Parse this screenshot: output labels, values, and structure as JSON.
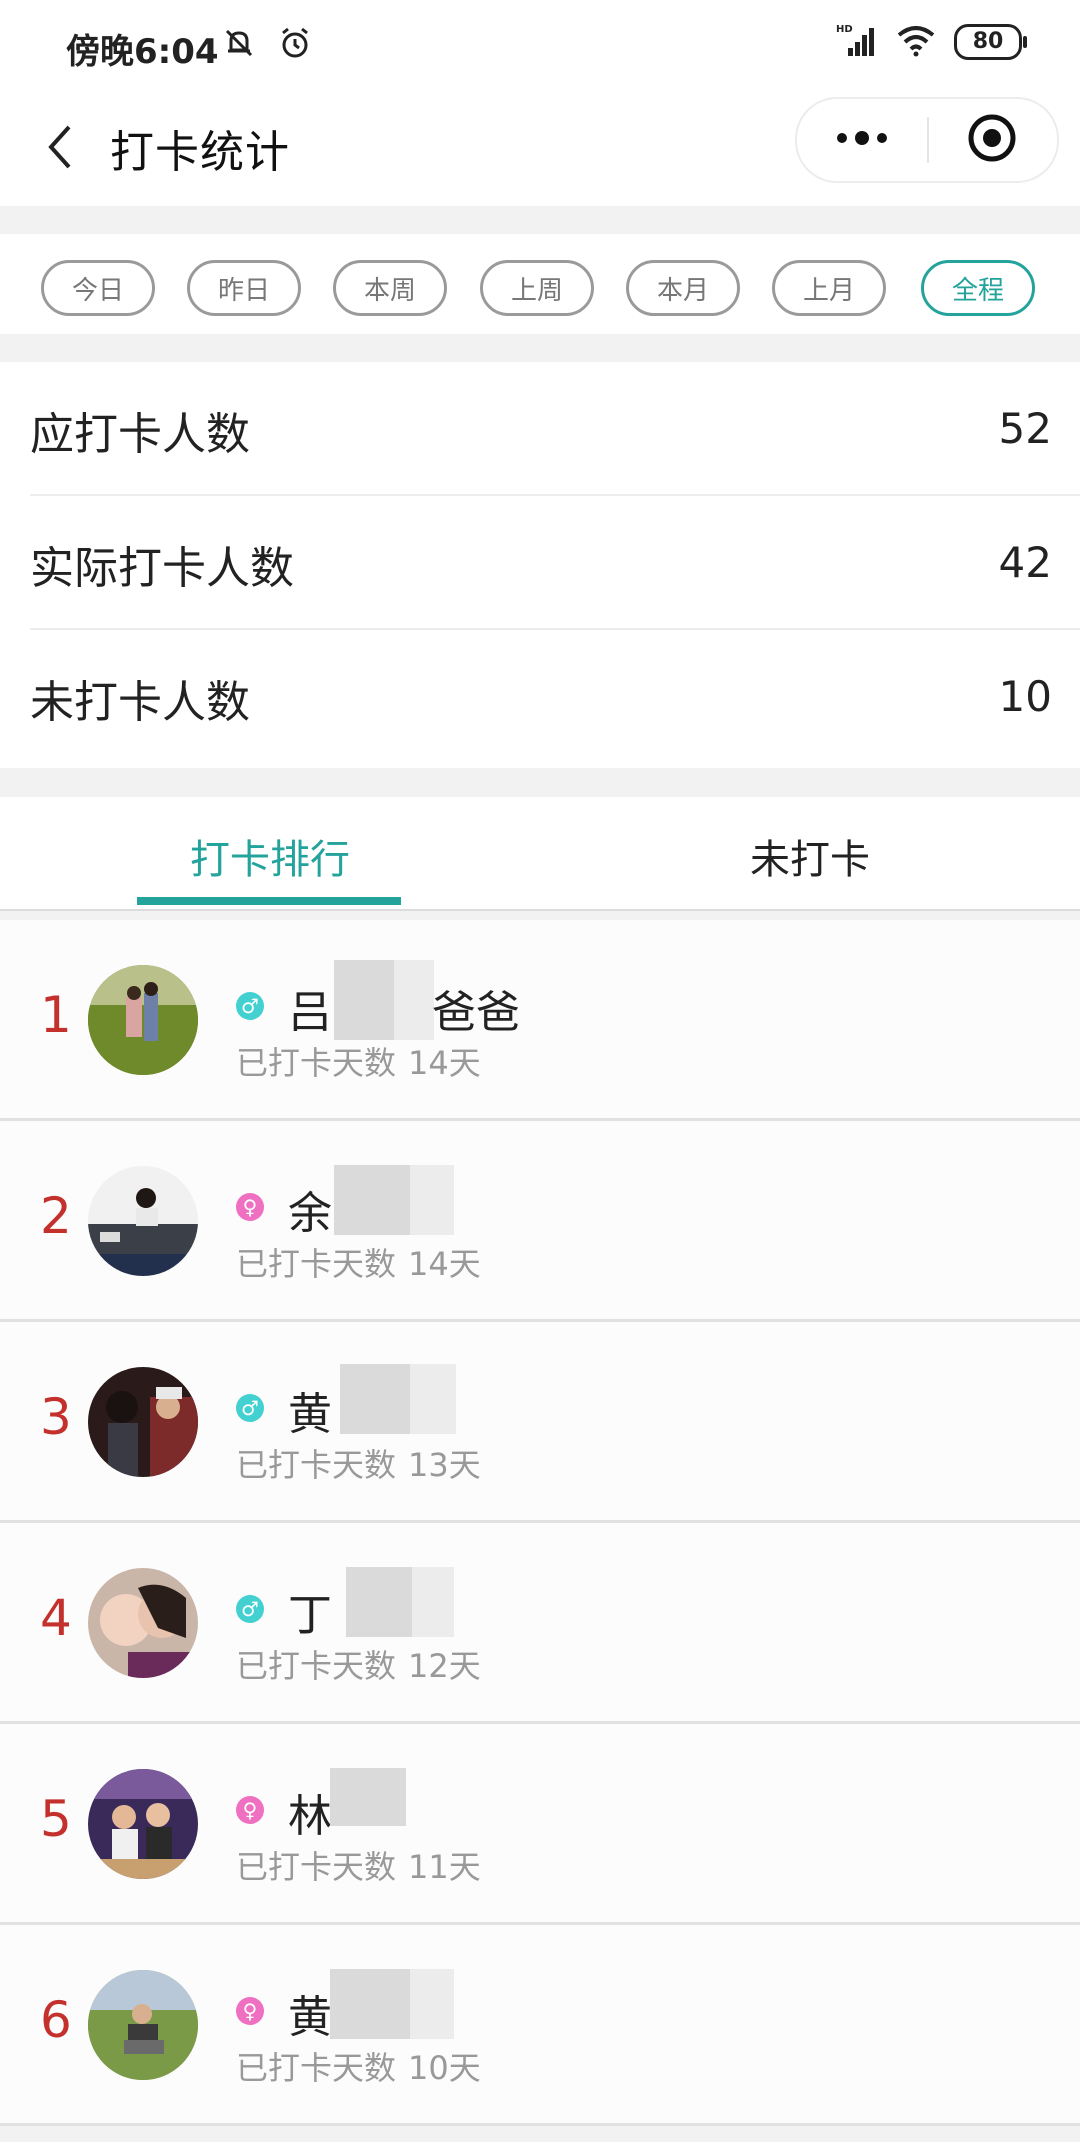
{
  "status_bar": {
    "time": "傍晚6:04",
    "battery": "80",
    "network_label": "HD"
  },
  "title_bar": {
    "title": "打卡统计"
  },
  "filters": [
    {
      "label": "今日",
      "active": false
    },
    {
      "label": "昨日",
      "active": false
    },
    {
      "label": "本周",
      "active": false
    },
    {
      "label": "上周",
      "active": false
    },
    {
      "label": "本月",
      "active": false
    },
    {
      "label": "上月",
      "active": false
    },
    {
      "label": "全程",
      "active": true
    }
  ],
  "stats": [
    {
      "label": "应打卡人数",
      "value": "52"
    },
    {
      "label": "实际打卡人数",
      "value": "42"
    },
    {
      "label": "未打卡人数",
      "value": "10"
    }
  ],
  "tabs": [
    {
      "label": "打卡排行",
      "active": true
    },
    {
      "label": "未打卡",
      "active": false
    }
  ],
  "ranking": [
    {
      "rank": "1",
      "gender": "♂",
      "name_prefix": "吕",
      "name_suffix": "爸爸",
      "days_label": "已打卡天数",
      "days": "14天"
    },
    {
      "rank": "2",
      "gender": "♀",
      "name_prefix": "余",
      "name_suffix": "",
      "days_label": "已打卡天数",
      "days": "14天"
    },
    {
      "rank": "3",
      "gender": "♂",
      "name_prefix": "黄",
      "name_suffix": "",
      "days_label": "已打卡天数",
      "days": "13天"
    },
    {
      "rank": "4",
      "gender": "♂",
      "name_prefix": "丁",
      "name_suffix": "",
      "days_label": "已打卡天数",
      "days": "12天"
    },
    {
      "rank": "5",
      "gender": "♀",
      "name_prefix": "林",
      "name_suffix": "",
      "days_label": "已打卡天数",
      "days": "11天"
    },
    {
      "rank": "6",
      "gender": "♀",
      "name_prefix": "黄",
      "name_suffix": "",
      "days_label": "已打卡天数",
      "days": "10天"
    }
  ],
  "colors": {
    "accent": "#23a39c",
    "rank": "#c4302b",
    "male": "#43d0d0",
    "female": "#ef6fc1"
  }
}
